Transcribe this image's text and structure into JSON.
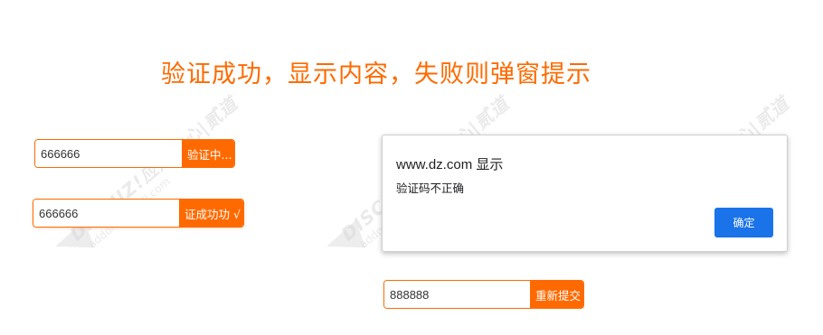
{
  "headline": "验证成功，显示内容，失败则弹窗提示",
  "watermark": {
    "line1": "DISCUZ!应用中心|贰道",
    "line2": "addon.dismall.com"
  },
  "form1": {
    "value": "666666",
    "button": "验证中..."
  },
  "form2": {
    "value": "666666",
    "button": "证成功功 √"
  },
  "form3": {
    "value": "888888",
    "button": "重新提交"
  },
  "dialog": {
    "title": "www.dz.com 显示",
    "message": "验证码不正确",
    "ok": "确定"
  },
  "colors": {
    "accent": "#ff6a00",
    "dialog_button": "#1a73e8"
  }
}
